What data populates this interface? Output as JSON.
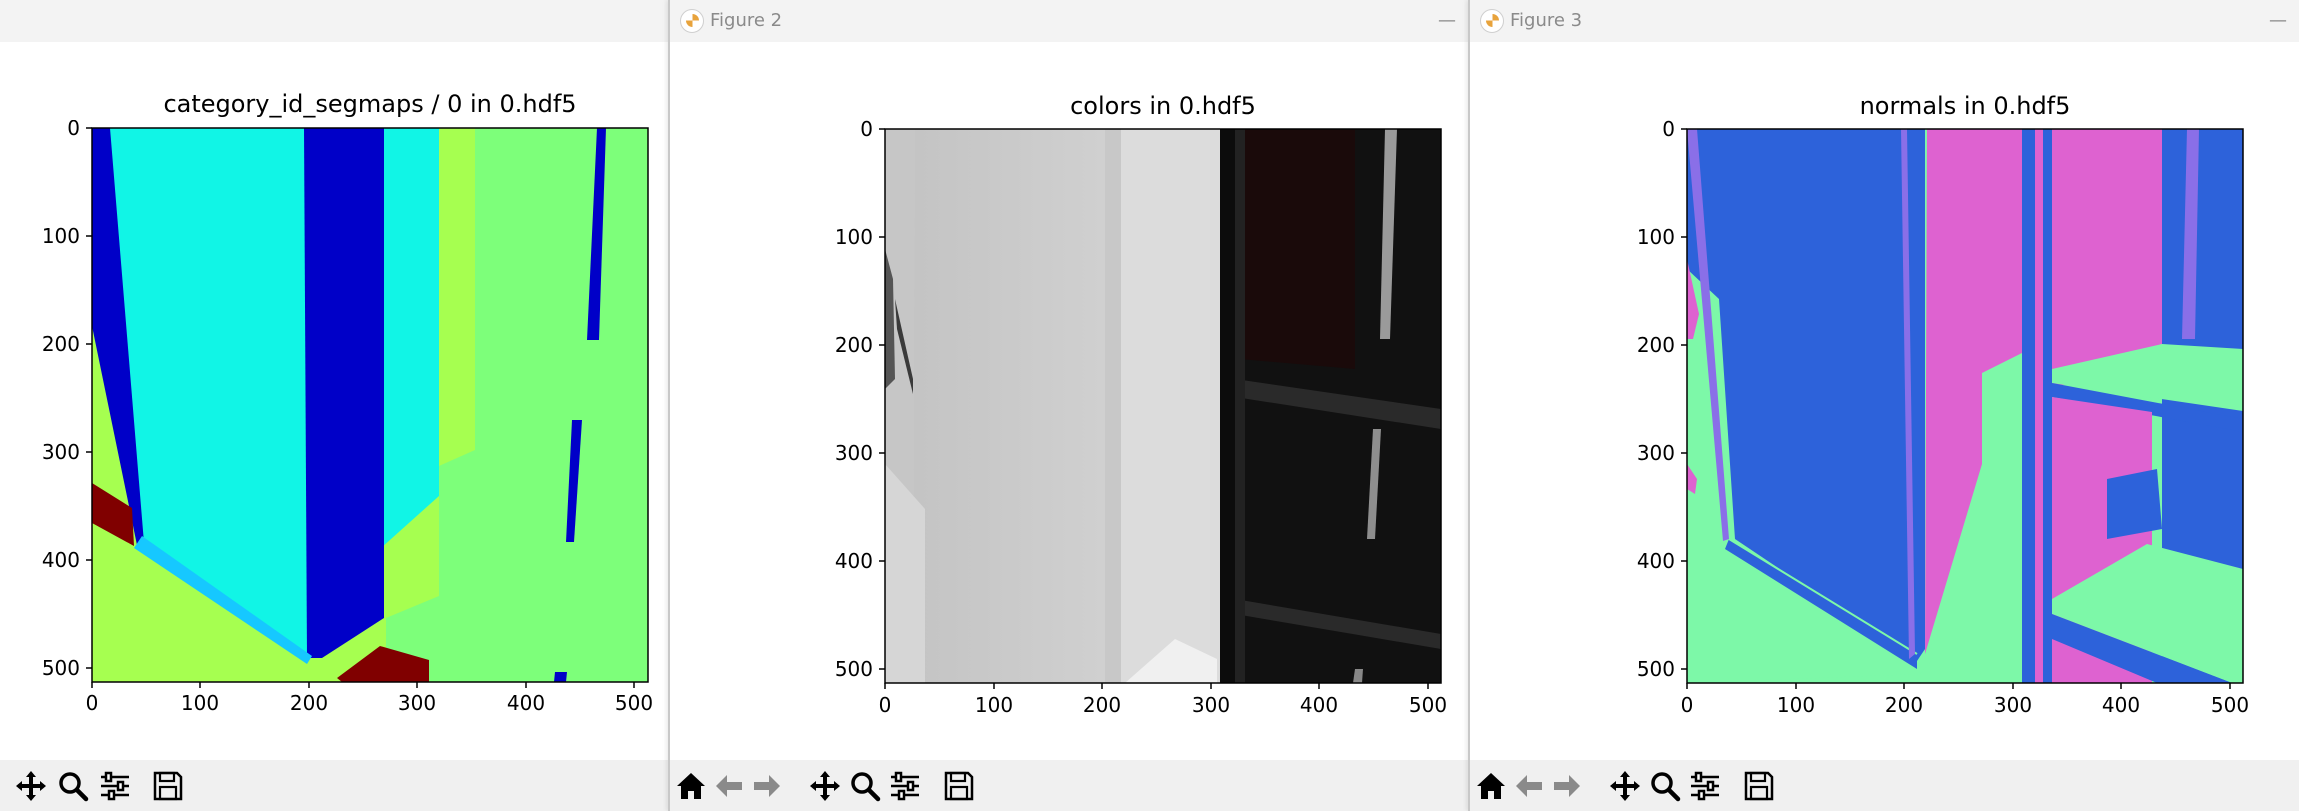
{
  "windows": [
    {
      "title": "",
      "plot_title": "category_id_segmaps / 0 in 0.hdf5",
      "toolbar": [
        "move-icon",
        "zoom-icon",
        "configure-icon",
        "save-icon"
      ]
    },
    {
      "title": "Figure 2",
      "plot_title": "colors in 0.hdf5",
      "toolbar": [
        "home-icon",
        "back-icon",
        "forward-icon",
        "move-icon",
        "zoom-icon",
        "configure-icon",
        "save-icon"
      ]
    },
    {
      "title": "Figure 3",
      "plot_title": "normals in 0.hdf5",
      "toolbar": [
        "home-icon",
        "back-icon",
        "forward-icon",
        "move-icon",
        "zoom-icon",
        "configure-icon",
        "save-icon"
      ]
    }
  ],
  "minimize_glyph": "—",
  "axis": {
    "x_ticks": [
      "0",
      "100",
      "200",
      "300",
      "400",
      "500"
    ],
    "y_ticks": [
      "0",
      "100",
      "200",
      "300",
      "400",
      "500"
    ]
  },
  "colors": {
    "seg_blue": "#0000c8",
    "seg_cyan": "#11f5e6",
    "seg_green": "#7dff7a",
    "seg_lime": "#a6ff50",
    "seg_red": "#800000",
    "seg_lightblue": "#16c8ff",
    "norm_blue": "#2d62da",
    "norm_pink": "#de62d0",
    "norm_green": "#7df8a8"
  }
}
